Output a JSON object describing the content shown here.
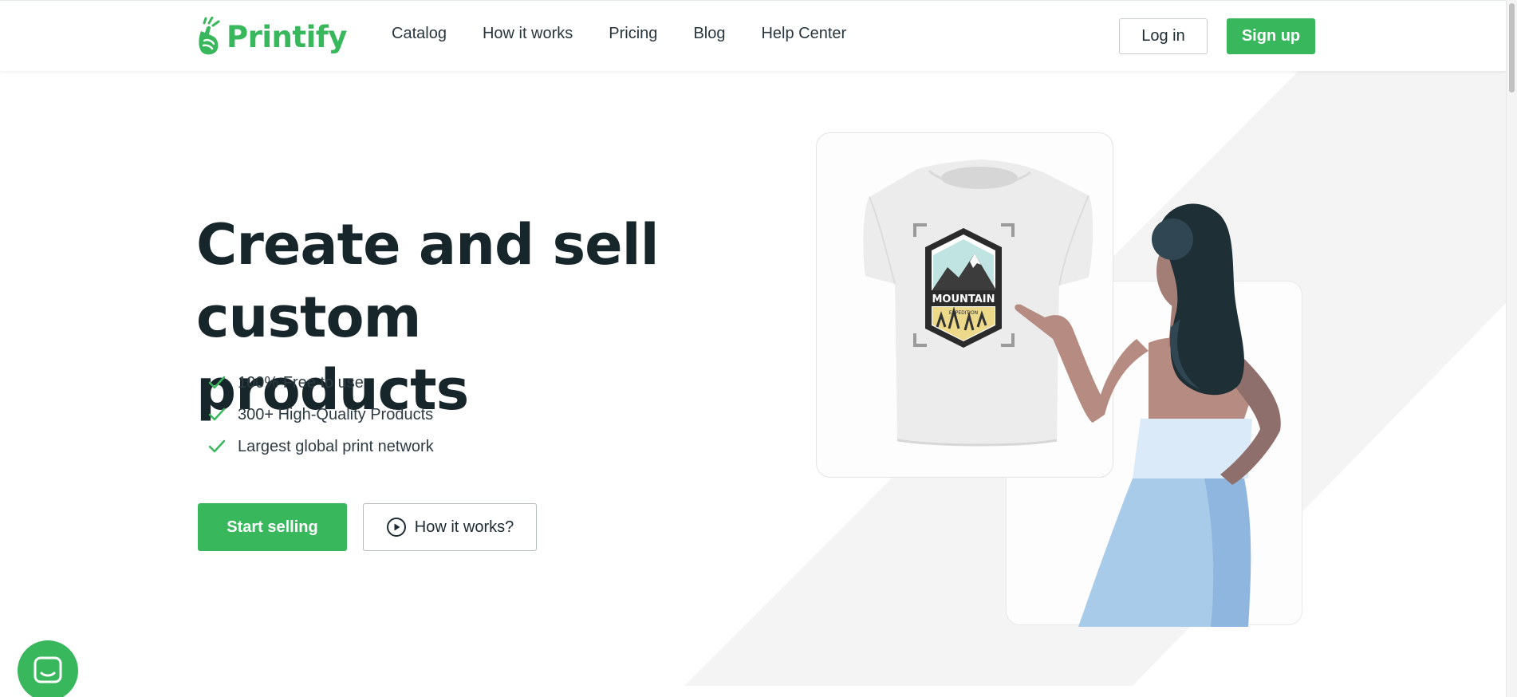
{
  "brand": {
    "name": "Printify",
    "accent": "#39b75d",
    "text_dark": "#17262b"
  },
  "nav": {
    "items": [
      {
        "label": "Catalog"
      },
      {
        "label": "How it works"
      },
      {
        "label": "Pricing"
      },
      {
        "label": "Blog"
      },
      {
        "label": "Help Center"
      }
    ]
  },
  "header": {
    "login_label": "Log in",
    "signup_label": "Sign up"
  },
  "hero": {
    "title_line1": "Create and sell",
    "title_line2": "custom products",
    "features": [
      "100% Free to use",
      "300+ High-Quality Products",
      "Largest global print network"
    ],
    "start_label": "Start selling",
    "how_label": "How it works?"
  },
  "illustration": {
    "badge_title": "MOUNTAIN",
    "badge_subtitle": "EXPEDITION"
  },
  "icons": {
    "logo": "printify-hand-icon",
    "feature_bullet": "check-icon",
    "play": "play-circle-icon",
    "chat": "chat-icon"
  }
}
